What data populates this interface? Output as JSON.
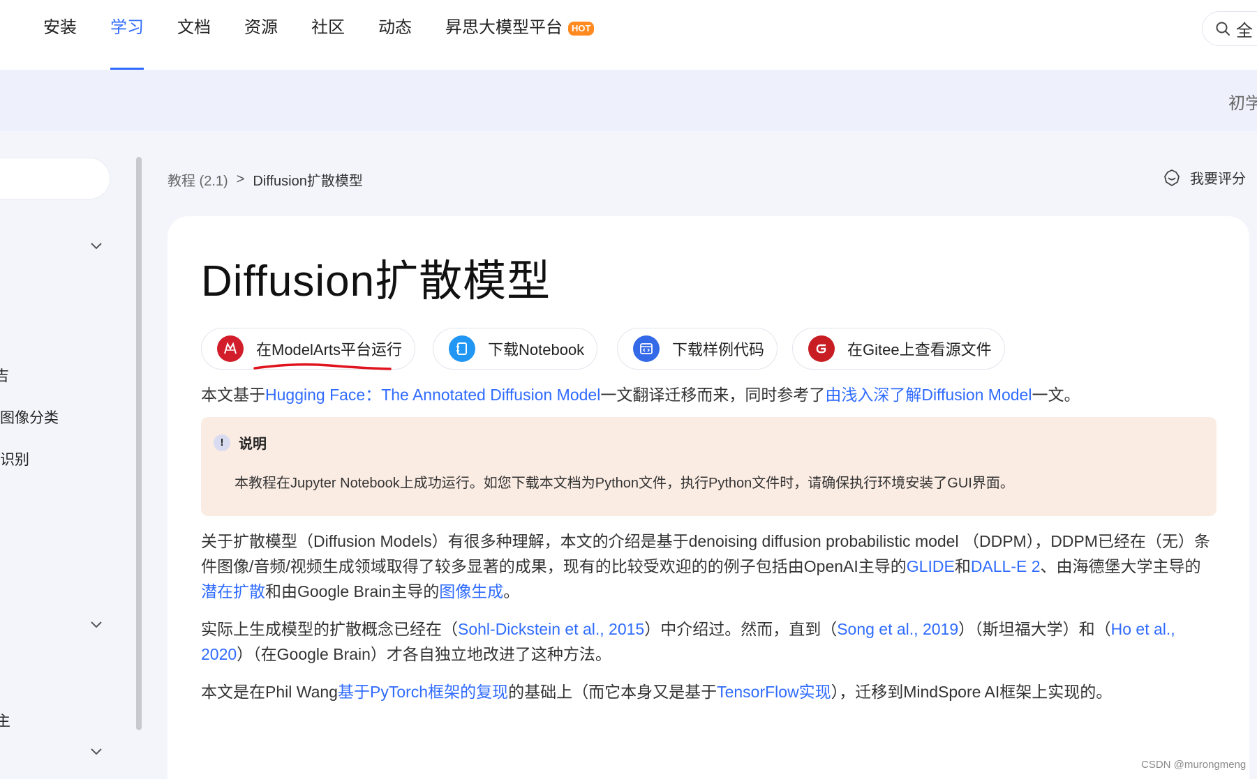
{
  "nav": {
    "items": [
      {
        "label": "安装",
        "active": false
      },
      {
        "label": "学习",
        "active": true
      },
      {
        "label": "文档",
        "active": false
      },
      {
        "label": "资源",
        "active": false
      },
      {
        "label": "社区",
        "active": false
      },
      {
        "label": "动态",
        "active": false
      },
      {
        "label": "昇思大模型平台",
        "active": false
      }
    ],
    "hot_badge": "HOT",
    "search_text": "全",
    "accent_color": "#2f6bff",
    "hot_color": "#ff8a1f"
  },
  "banner": {
    "level_text": "初学"
  },
  "sidebar": {
    "items": [
      "吉",
      "图像分类",
      "识别",
      "主"
    ]
  },
  "breadcrumb": {
    "parent": "教程 (2.1)",
    "separator": ">",
    "current": "Diffusion扩散模型"
  },
  "rate_label": "我要评分",
  "article": {
    "title": "Diffusion扩散模型",
    "buttons": [
      {
        "label": "在ModelArts平台运行",
        "icon": "modelarts-icon"
      },
      {
        "label": "下载Notebook",
        "icon": "notebook-icon"
      },
      {
        "label": "下载样例代码",
        "icon": "code-icon"
      },
      {
        "label": "在Gitee上查看源文件",
        "icon": "gitee-icon"
      }
    ],
    "intro": {
      "t1": "本文基于",
      "link1": "Hugging Face：The Annotated Diffusion Model",
      "t2": "一文翻译迁移而来，同时参考了",
      "link2": "由浅入深了解Diffusion Model",
      "t3": "一文。"
    },
    "note": {
      "heading": "说明",
      "body": "本教程在Jupyter Notebook上成功运行。如您下载本文档为Python文件，执行Python文件时，请确保执行环境安装了GUI界面。"
    },
    "p1": {
      "t1": "关于扩散模型（Diffusion Models）有很多种理解，本文的介绍是基于denoising diffusion probabilistic model （DDPM），DDPM已经在（无）条件图像/音频/视频生成领域取得了较多显著的成果，现有的比较受欢迎的的例子包括由OpenAI主导的",
      "link1": "GLIDE",
      "t2": "和",
      "link2": "DALL-E 2",
      "t3": "、由海德堡大学主导的",
      "link3": "潜在扩散",
      "t4": "和由Google Brain主导的",
      "link4": "图像生成",
      "t5": "。"
    },
    "p2": {
      "t1": "实际上生成模型的扩散概念已经在（",
      "link1": "Sohl-Dickstein et al., 2015",
      "t2": "）中介绍过。然而，直到（",
      "link2": "Song et al., 2019",
      "t3": "）（斯坦福大学）和（",
      "link3": "Ho et al., 2020",
      "t4": "）（在Google Brain）才各自独立地改进了这种方法。"
    },
    "p3": {
      "t1": "本文是在Phil Wang",
      "link1": "基于PyTorch框架的复现",
      "t2": "的基础上（而它本身又是基于",
      "link2": "TensorFlow实现",
      "t3": "），迁移到MindSpore AI框架上实现的。"
    }
  },
  "watermark": "CSDN @murongmeng"
}
